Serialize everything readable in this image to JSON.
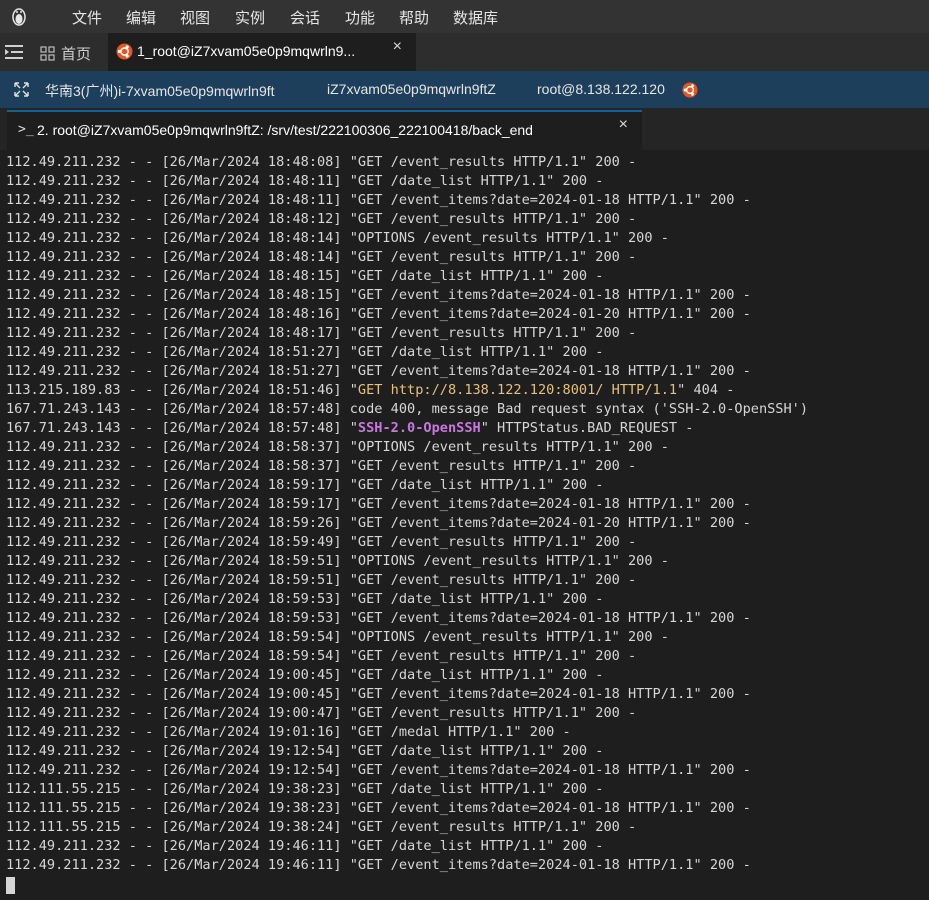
{
  "menubar": {
    "items": [
      "文件",
      "编辑",
      "视图",
      "实例",
      "会话",
      "功能",
      "帮助",
      "数据库"
    ]
  },
  "tabs": {
    "home_label": "首页",
    "active_label": "1_root@iZ7xvam05e0p9mqwrln9...",
    "close": "×"
  },
  "infobar": {
    "region": "华南3(广州)i-7xvam05e0p9mqwrln9ft",
    "host": "iZ7xvam05e0p9mqwrln9ftZ",
    "user": "root@8.138.122.120"
  },
  "terminal_tab": {
    "label": "2. root@iZ7xvam05e0p9mqwrln9ftZ: /srv/test/222100306_222100418/back_end",
    "close": "×"
  },
  "colors": {
    "accent": "#0e639c",
    "get_highlight": "#e5c07b",
    "ssh_highlight": "#c678dd"
  },
  "log_lines": [
    {
      "pre": "112.49.211.232 - - [26/Mar/2024 18:48:08] \"GET /event_results HTTP/1.1\" 200 -"
    },
    {
      "pre": "112.49.211.232 - - [26/Mar/2024 18:48:11] \"GET /date_list HTTP/1.1\" 200 -"
    },
    {
      "pre": "112.49.211.232 - - [26/Mar/2024 18:48:11] \"GET /event_items?date=2024-01-18 HTTP/1.1\" 200 -"
    },
    {
      "pre": "112.49.211.232 - - [26/Mar/2024 18:48:12] \"GET /event_results HTTP/1.1\" 200 -"
    },
    {
      "pre": "112.49.211.232 - - [26/Mar/2024 18:48:14] \"OPTIONS /event_results HTTP/1.1\" 200 -"
    },
    {
      "pre": "112.49.211.232 - - [26/Mar/2024 18:48:14] \"GET /event_results HTTP/1.1\" 200 -"
    },
    {
      "pre": "112.49.211.232 - - [26/Mar/2024 18:48:15] \"GET /date_list HTTP/1.1\" 200 -"
    },
    {
      "pre": "112.49.211.232 - - [26/Mar/2024 18:48:15] \"GET /event_items?date=2024-01-18 HTTP/1.1\" 200 -"
    },
    {
      "pre": "112.49.211.232 - - [26/Mar/2024 18:48:16] \"GET /event_items?date=2024-01-20 HTTP/1.1\" 200 -"
    },
    {
      "pre": "112.49.211.232 - - [26/Mar/2024 18:48:17] \"GET /event_results HTTP/1.1\" 200 -"
    },
    {
      "pre": "112.49.211.232 - - [26/Mar/2024 18:51:27] \"GET /date_list HTTP/1.1\" 200 -"
    },
    {
      "pre": "112.49.211.232 - - [26/Mar/2024 18:51:27] \"GET /event_items?date=2024-01-18 HTTP/1.1\" 200 -"
    },
    {
      "pre": "113.215.189.83 - - [26/Mar/2024 18:51:46] \"",
      "hl": "GET http://8.138.122.120:8001/ HTTP/1.1",
      "hl_kind": "yellow",
      "post": "\" 404 -"
    },
    {
      "pre": "167.71.243.143 - - [26/Mar/2024 18:57:48] code 400, message Bad request syntax ('SSH-2.0-OpenSSH')"
    },
    {
      "pre": "167.71.243.143 - - [26/Mar/2024 18:57:48] \"",
      "hl": "SSH-2.0-OpenSSH",
      "hl_kind": "purple",
      "post": "\" HTTPStatus.BAD_REQUEST -"
    },
    {
      "pre": "112.49.211.232 - - [26/Mar/2024 18:58:37] \"OPTIONS /event_results HTTP/1.1\" 200 -"
    },
    {
      "pre": "112.49.211.232 - - [26/Mar/2024 18:58:37] \"GET /event_results HTTP/1.1\" 200 -"
    },
    {
      "pre": "112.49.211.232 - - [26/Mar/2024 18:59:17] \"GET /date_list HTTP/1.1\" 200 -"
    },
    {
      "pre": "112.49.211.232 - - [26/Mar/2024 18:59:17] \"GET /event_items?date=2024-01-18 HTTP/1.1\" 200 -"
    },
    {
      "pre": "112.49.211.232 - - [26/Mar/2024 18:59:26] \"GET /event_items?date=2024-01-20 HTTP/1.1\" 200 -"
    },
    {
      "pre": "112.49.211.232 - - [26/Mar/2024 18:59:49] \"GET /event_results HTTP/1.1\" 200 -"
    },
    {
      "pre": "112.49.211.232 - - [26/Mar/2024 18:59:51] \"OPTIONS /event_results HTTP/1.1\" 200 -"
    },
    {
      "pre": "112.49.211.232 - - [26/Mar/2024 18:59:51] \"GET /event_results HTTP/1.1\" 200 -"
    },
    {
      "pre": "112.49.211.232 - - [26/Mar/2024 18:59:53] \"GET /date_list HTTP/1.1\" 200 -"
    },
    {
      "pre": "112.49.211.232 - - [26/Mar/2024 18:59:53] \"GET /event_items?date=2024-01-18 HTTP/1.1\" 200 -"
    },
    {
      "pre": "112.49.211.232 - - [26/Mar/2024 18:59:54] \"OPTIONS /event_results HTTP/1.1\" 200 -"
    },
    {
      "pre": "112.49.211.232 - - [26/Mar/2024 18:59:54] \"GET /event_results HTTP/1.1\" 200 -"
    },
    {
      "pre": "112.49.211.232 - - [26/Mar/2024 19:00:45] \"GET /date_list HTTP/1.1\" 200 -"
    },
    {
      "pre": "112.49.211.232 - - [26/Mar/2024 19:00:45] \"GET /event_items?date=2024-01-18 HTTP/1.1\" 200 -"
    },
    {
      "pre": "112.49.211.232 - - [26/Mar/2024 19:00:47] \"GET /event_results HTTP/1.1\" 200 -"
    },
    {
      "pre": "112.49.211.232 - - [26/Mar/2024 19:01:16] \"GET /medal HTTP/1.1\" 200 -"
    },
    {
      "pre": "112.49.211.232 - - [26/Mar/2024 19:12:54] \"GET /date_list HTTP/1.1\" 200 -"
    },
    {
      "pre": "112.49.211.232 - - [26/Mar/2024 19:12:54] \"GET /event_items?date=2024-01-18 HTTP/1.1\" 200 -"
    },
    {
      "pre": "112.111.55.215 - - [26/Mar/2024 19:38:23] \"GET /date_list HTTP/1.1\" 200 -"
    },
    {
      "pre": "112.111.55.215 - - [26/Mar/2024 19:38:23] \"GET /event_items?date=2024-01-18 HTTP/1.1\" 200 -"
    },
    {
      "pre": "112.111.55.215 - - [26/Mar/2024 19:38:24] \"GET /event_results HTTP/1.1\" 200 -"
    },
    {
      "pre": "112.49.211.232 - - [26/Mar/2024 19:46:11] \"GET /date_list HTTP/1.1\" 200 -"
    },
    {
      "pre": "112.49.211.232 - - [26/Mar/2024 19:46:11] \"GET /event_items?date=2024-01-18 HTTP/1.1\" 200 -"
    }
  ]
}
